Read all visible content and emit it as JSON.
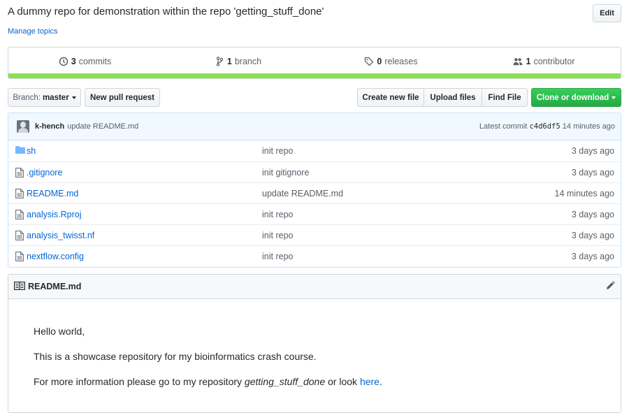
{
  "repo": {
    "description": "A dummy repo for demonstration within the repo 'getting_stuff_done'",
    "manage_topics": "Manage topics",
    "edit_label": "Edit"
  },
  "summary": {
    "commits_count": "3",
    "commits_label": "commits",
    "branch_count": "1",
    "branch_label": "branch",
    "releases_count": "0",
    "releases_label": "releases",
    "contributor_count": "1",
    "contributor_label": "contributor",
    "language_color": "#89e051"
  },
  "toolbar": {
    "branch_prefix": "Branch:",
    "branch_name": "master",
    "new_pr": "New pull request",
    "create_file": "Create new file",
    "upload_files": "Upload files",
    "find_file": "Find File",
    "clone": "Clone or download",
    "clone_color": "#28a745"
  },
  "latest_commit": {
    "author": "k-hench",
    "message": "update README.md",
    "prefix": "Latest commit",
    "sha": "c4d6df5",
    "age": "14 minutes ago"
  },
  "files": [
    {
      "name": "sh",
      "type": "folder",
      "icon": "folder-icon",
      "message": "init repo",
      "age": "3 days ago"
    },
    {
      "name": ".gitignore",
      "type": "file",
      "icon": "file-icon",
      "message": "init gitignore",
      "age": "3 days ago"
    },
    {
      "name": "README.md",
      "type": "file",
      "icon": "file-icon",
      "message": "update README.md",
      "age": "14 minutes ago"
    },
    {
      "name": "analysis.Rproj",
      "type": "file",
      "icon": "file-icon",
      "message": "init repo",
      "age": "3 days ago"
    },
    {
      "name": "analysis_twisst.nf",
      "type": "file",
      "icon": "file-icon",
      "message": "init repo",
      "age": "3 days ago"
    },
    {
      "name": "nextflow.config",
      "type": "file",
      "icon": "file-icon",
      "message": "init repo",
      "age": "3 days ago"
    }
  ],
  "readme": {
    "title": "README.md",
    "line1": "Hello world,",
    "line2": "This is a showcase repository for my bioinformatics crash course.",
    "line3_prefix": "For more information please go to my repository ",
    "line3_repo": "getting_stuff_done",
    "line3_mid": " or look ",
    "line3_link": "here",
    "line3_end": "."
  }
}
